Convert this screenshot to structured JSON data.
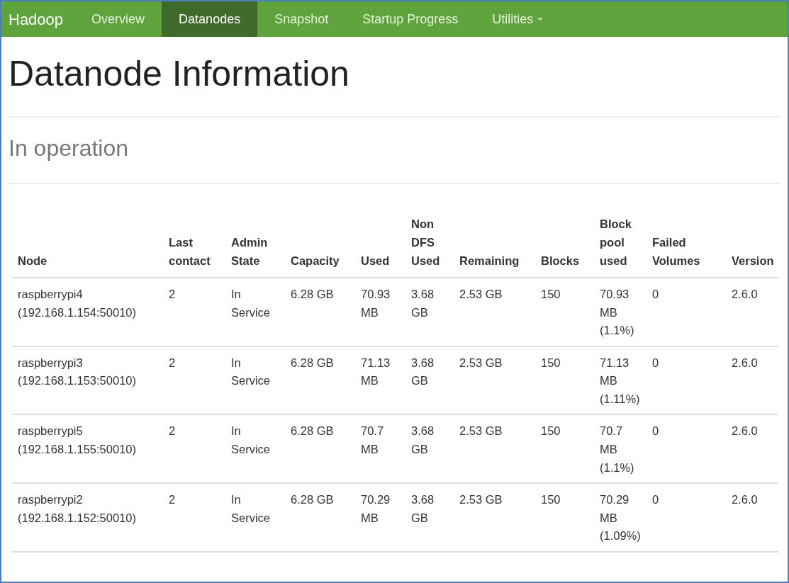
{
  "navbar": {
    "brand": "Hadoop",
    "items": [
      {
        "label": "Overview",
        "selected": false,
        "dropdown": false
      },
      {
        "label": "Datanodes",
        "selected": true,
        "dropdown": false
      },
      {
        "label": "Snapshot",
        "selected": false,
        "dropdown": false
      },
      {
        "label": "Startup Progress",
        "selected": false,
        "dropdown": false
      },
      {
        "label": "Utilities",
        "selected": false,
        "dropdown": true
      }
    ]
  },
  "page_title": "Datanode Information",
  "section_title": "In operation",
  "table": {
    "columns": [
      "Node",
      "Last contact",
      "Admin State",
      "Capacity",
      "Used",
      "Non DFS Used",
      "Remaining",
      "Blocks",
      "Block pool used",
      "Failed Volumes",
      "Version"
    ],
    "rows": [
      [
        "raspberrypi4 (192.168.1.154:50010)",
        "2",
        "In Service",
        "6.28 GB",
        "70.93 MB",
        "3.68 GB",
        "2.53 GB",
        "150",
        "70.93 MB (1.1%)",
        "0",
        "2.6.0"
      ],
      [
        "raspberrypi3 (192.168.1.153:50010)",
        "2",
        "In Service",
        "6.28 GB",
        "71.13 MB",
        "3.68 GB",
        "2.53 GB",
        "150",
        "71.13 MB (1.11%)",
        "0",
        "2.6.0"
      ],
      [
        "raspberrypi5 (192.168.1.155:50010)",
        "2",
        "In Service",
        "6.28 GB",
        "70.7 MB",
        "3.68 GB",
        "2.53 GB",
        "150",
        "70.7 MB (1.1%)",
        "0",
        "2.6.0"
      ],
      [
        "raspberrypi2 (192.168.1.152:50010)",
        "2",
        "In Service",
        "6.28 GB",
        "70.29 MB",
        "3.68 GB",
        "2.53 GB",
        "150",
        "70.29 MB (1.09%)",
        "0",
        "2.6.0"
      ]
    ]
  }
}
